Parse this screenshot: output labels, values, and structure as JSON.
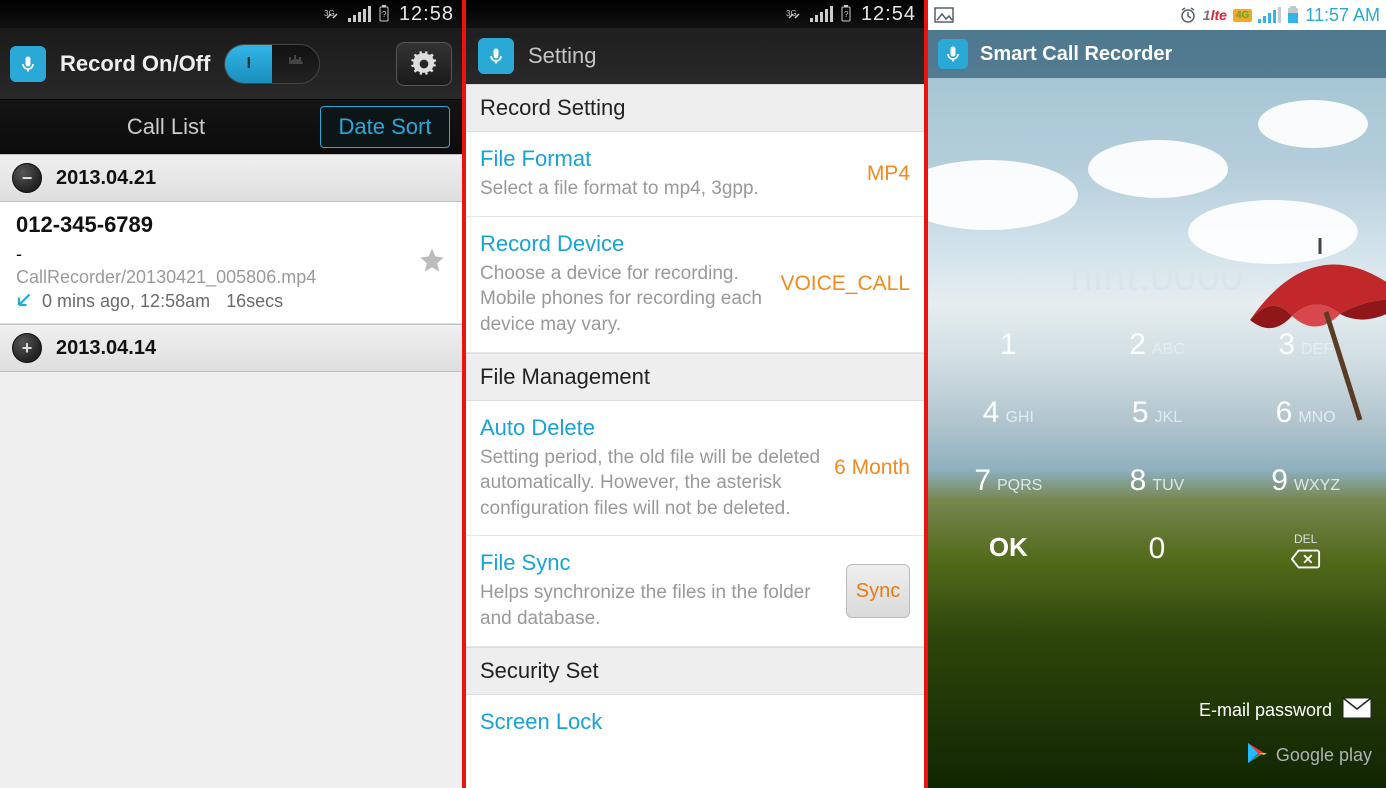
{
  "screen1": {
    "status": {
      "time": "12:58"
    },
    "title": "Record On/Off",
    "toggle": {
      "on_label": "I",
      "off_glyph": "|||"
    },
    "subbar": {
      "call_list": "Call List",
      "date_sort": "Date Sort"
    },
    "groups": [
      {
        "icon": "minus",
        "date": "2013.04.21"
      },
      {
        "icon": "plus",
        "date": "2013.04.14"
      }
    ],
    "call": {
      "phone": "012-345-6789",
      "dash": "-",
      "path": "CallRecorder/20130421_005806.mp4",
      "timeago": "0 mins ago, 12:58am",
      "duration": "16secs"
    }
  },
  "screen2": {
    "status": {
      "time": "12:54"
    },
    "title": "Setting",
    "sections": {
      "record": "Record Setting",
      "file": "File Management",
      "security": "Security Set"
    },
    "rows": {
      "file_format": {
        "title": "File Format",
        "desc": "Select a file format to mp4, 3gpp.",
        "value": "MP4"
      },
      "record_device": {
        "title": "Record Device",
        "desc": "Choose a device for recording. Mobile phones for recording each device may vary.",
        "value": "VOICE_CALL"
      },
      "auto_delete": {
        "title": "Auto Delete",
        "desc": "Setting period, the old file will be deleted automatically. However, the asterisk configuration files will not be deleted.",
        "value": "6 Month"
      },
      "file_sync": {
        "title": "File Sync",
        "desc": "Helps synchronize the files in the folder and database.",
        "button": "Sync"
      },
      "screen_lock": {
        "title": "Screen Lock"
      }
    }
  },
  "screen3": {
    "status": {
      "time": "11:57 AM",
      "lte": "lte",
      "fourg": "4G"
    },
    "app_title": "Smart Call Recorder",
    "hint": "hint:0000",
    "keypad": [
      {
        "num": "1",
        "sub": ""
      },
      {
        "num": "2",
        "sub": "ABC"
      },
      {
        "num": "3",
        "sub": "DEF"
      },
      {
        "num": "4",
        "sub": "GHI"
      },
      {
        "num": "5",
        "sub": "JKL"
      },
      {
        "num": "6",
        "sub": "MNO"
      },
      {
        "num": "7",
        "sub": "PQRS"
      },
      {
        "num": "8",
        "sub": "TUV"
      },
      {
        "num": "9",
        "sub": "WXYZ"
      },
      {
        "num": "OK",
        "sub": ""
      },
      {
        "num": "0",
        "sub": ""
      },
      {
        "num": "DEL",
        "sub": ""
      }
    ],
    "email_password": "E-mail password",
    "google_play": "Google play"
  }
}
